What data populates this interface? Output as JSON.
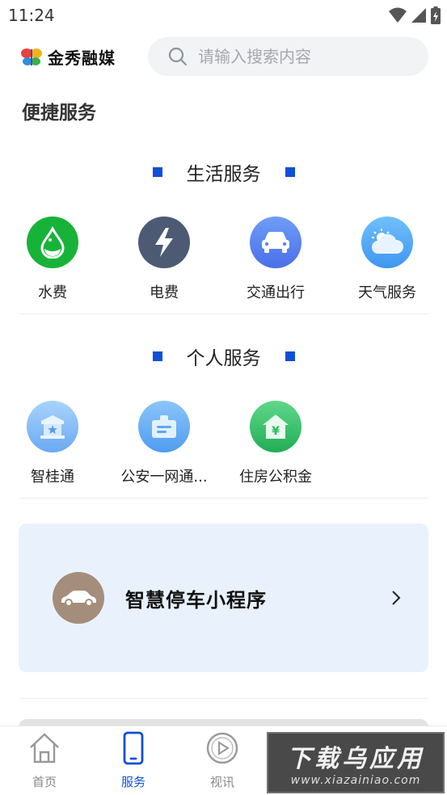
{
  "status": {
    "time": "11:24"
  },
  "header": {
    "logo_text": "金秀融媒",
    "search_placeholder": "请输入搜索内容"
  },
  "page_title": "便捷服务",
  "sections": [
    {
      "title": "生活服务",
      "items": [
        {
          "label": "水费",
          "icon": "water-drop-icon",
          "color": "#17b338"
        },
        {
          "label": "电费",
          "icon": "lightning-icon",
          "color": "#4c5a73"
        },
        {
          "label": "交通出行",
          "icon": "car-icon",
          "color": "#5b84f0"
        },
        {
          "label": "天气服务",
          "icon": "cloud-sun-icon",
          "color": "#48a7f5"
        }
      ]
    },
    {
      "title": "个人服务",
      "items": [
        {
          "label": "智桂通",
          "icon": "building-star-icon",
          "color": "#7fb7f7"
        },
        {
          "label": "公安一网通...",
          "icon": "badge-icon",
          "color": "#5aaaf0"
        },
        {
          "label": "住房公积金",
          "icon": "house-yuan-icon",
          "color": "#33c266"
        }
      ]
    }
  ],
  "banner": {
    "title": "智慧停车小程序",
    "icon": "car-icon"
  },
  "tabbar": [
    {
      "label": "首页",
      "icon": "home-icon",
      "active": false
    },
    {
      "label": "服务",
      "icon": "phone-icon",
      "active": true
    },
    {
      "label": "视讯",
      "icon": "play-icon",
      "active": false
    }
  ],
  "watermark": {
    "line1": "下载乌应用",
    "line2": "www.xiazainiao.com"
  },
  "colors": {
    "accent": "#1150d6",
    "banner_bg": "#e9f2fc"
  }
}
